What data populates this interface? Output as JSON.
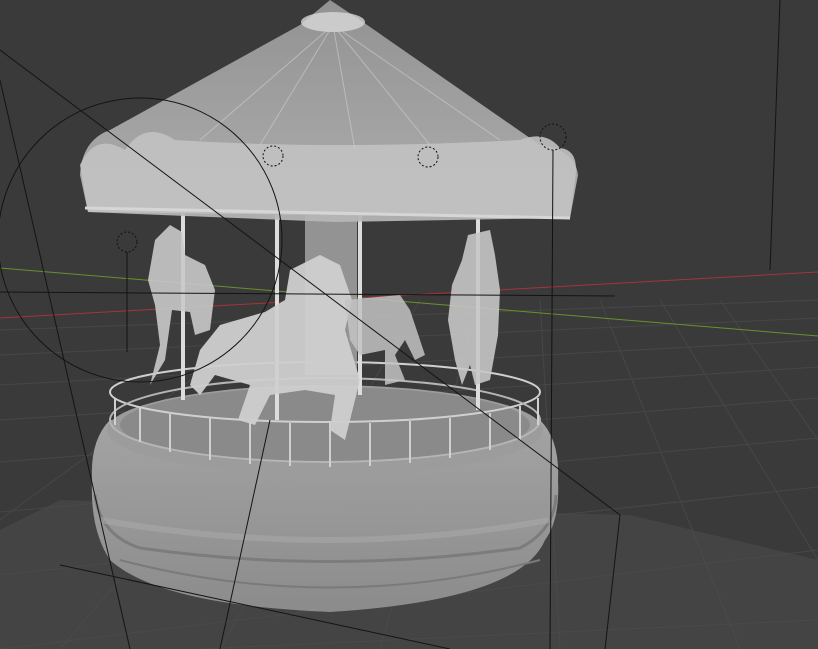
{
  "viewport": {
    "view": "perspective",
    "shading": "solid",
    "xray": true,
    "colors": {
      "background": "#3a3a3a",
      "grid": "#4a4a4a",
      "x_axis": "#a8323c",
      "y_axis": "#6a8f2c",
      "model": "#bdbdbd",
      "wire": "#1a1a1a"
    }
  },
  "scene": {
    "object": "carousel",
    "horses": 5,
    "lights": 4,
    "camera_outline": true
  }
}
